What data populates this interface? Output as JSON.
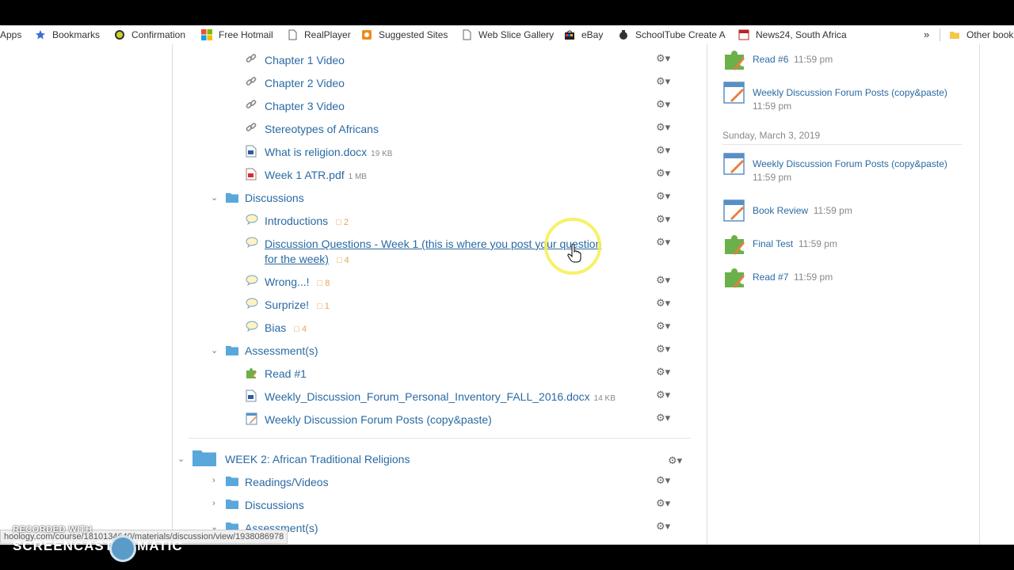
{
  "bookmarks": [
    {
      "label": "Apps",
      "icon": "apps-grid-icon"
    },
    {
      "label": "Bookmarks",
      "icon": "star-icon"
    },
    {
      "label": "Confirmation",
      "icon": "confirmation-icon"
    },
    {
      "label": "Free Hotmail",
      "icon": "windows-logo-icon"
    },
    {
      "label": "RealPlayer",
      "icon": "page-icon"
    },
    {
      "label": "Suggested Sites",
      "icon": "suggested-sites-icon"
    },
    {
      "label": "Web Slice Gallery",
      "icon": "page-icon"
    },
    {
      "label": "eBay",
      "icon": "ebay-bag-icon"
    },
    {
      "label": "SchoolTube Create A",
      "icon": "schooltube-icon"
    },
    {
      "label": "News24, South Africa",
      "icon": "news24-icon"
    }
  ],
  "bookmarks_overflow": "»",
  "other_bookmarks": "Other book",
  "materials": {
    "items_top": [
      {
        "label": "Chapter 1 Video",
        "icon": "link-icon"
      },
      {
        "label": "Chapter 2 Video",
        "icon": "link-icon"
      },
      {
        "label": "Chapter 3 Video",
        "icon": "link-icon"
      },
      {
        "label": "Stereotypes of Africans",
        "icon": "link-icon"
      },
      {
        "label": "What is religion.docx",
        "size": "19 KB",
        "icon": "docx-file-icon"
      },
      {
        "label": "Week 1 ATR.pdf",
        "size": "1 MB",
        "icon": "pdf-file-icon"
      }
    ],
    "discussions_folder": "Discussions",
    "discussions": [
      {
        "label": "Introductions",
        "count": "2"
      },
      {
        "label_line1": "Discussion Questions - Week 1 (this is where you post your question",
        "label_line2": "for the week)",
        "count": "4"
      },
      {
        "label": "Wrong...!",
        "count": "8"
      },
      {
        "label": "Surprize!",
        "count": "1"
      },
      {
        "label": "Bias",
        "count": "4"
      }
    ],
    "assessments_folder": "Assessment(s)",
    "assessments": [
      {
        "label": "Read #1",
        "icon": "puzzle-assessment-icon"
      },
      {
        "label": "Weekly_Discussion_Forum_Personal_Inventory_FALL_2016.docx",
        "size": "14 KB",
        "icon": "docx-file-icon"
      },
      {
        "label": "Weekly Discussion Forum Posts (copy&paste)",
        "icon": "assignment-icon"
      }
    ],
    "week2": {
      "title": "WEEK 2: African Traditional Religions",
      "folders": [
        "Readings/Videos",
        "Discussions",
        "Assessment(s)"
      ]
    }
  },
  "upcoming": [
    {
      "title": "Read #6",
      "time": "11:59 pm",
      "icon": "puzzle-assessment-icon"
    },
    {
      "title": "Weekly Discussion Forum Posts (copy&paste)",
      "time": "11:59 pm",
      "icon": "assignment-icon"
    }
  ],
  "upcoming_date": "Sunday, March 3, 2019",
  "upcoming2": [
    {
      "title": "Weekly Discussion Forum Posts (copy&paste)",
      "time": "11:59 pm",
      "icon": "assignment-icon"
    },
    {
      "title": "Book Review",
      "time": "11:59 pm",
      "icon": "assignment-icon"
    },
    {
      "title": "Final Test",
      "time": "11:59 pm",
      "icon": "puzzle-assessment-icon"
    },
    {
      "title": "Read #7",
      "time": "11:59 pm",
      "icon": "puzzle-assessment-icon"
    }
  ],
  "status_url": "hoology.com/course/1810134640/materials/discussion/view/1938086978",
  "watermark": {
    "recorded": "RECORDED WITH",
    "brand_left": "SCREENCAST",
    "brand_right": "MATIC"
  },
  "colors": {
    "link": "#2a6aa3",
    "folder": "#5aa7dc",
    "count": "#e8a35a",
    "cursor_ring": "#f5f05a"
  }
}
